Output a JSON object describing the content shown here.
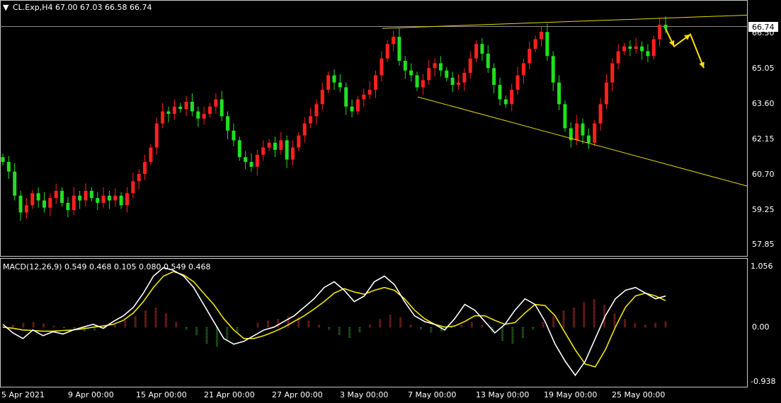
{
  "window": {
    "symbol_header": "CL.Exp,H4  67.00 67.03 66.58 66.74",
    "current_price": "66.74"
  },
  "price_axis": {
    "labels": [
      "66.50",
      "65.05",
      "63.60",
      "62.15",
      "60.70",
      "59.25",
      "57.85"
    ]
  },
  "macd": {
    "header": "MACD(12,26,9) 0.549 0.468 0.105 0.080 0.549 0.468",
    "labels": [
      "1.056",
      "0.00",
      "-0.938"
    ]
  },
  "time_axis": {
    "labels": [
      "5 Apr 2021",
      "9 Apr 00:00",
      "15 Apr 00:00",
      "21 Apr 00:00",
      "27 Apr 00:00",
      "3 May 00:00",
      "7 May 00:00",
      "13 May 00:00",
      "19 May 00:00",
      "25 May 00:00"
    ]
  },
  "colors": {
    "bull": "#ff2020",
    "bear": "#20e020",
    "macd_line": "#ffffff",
    "signal_line": "#f2e600",
    "trendline": "#e6d800",
    "arrow": "#ffe000",
    "grid_ref": "#8a8a8a"
  },
  "chart_data": {
    "type": "candlestick",
    "symbol": "CL.Exp",
    "timeframe": "H4",
    "ohlc_last": {
      "open": 67.0,
      "high": 67.03,
      "low": 66.58,
      "close": 66.74
    },
    "y_range": [
      57.5,
      67.4
    ],
    "closes": [
      61.2,
      60.8,
      59.8,
      59.1,
      59.4,
      59.9,
      59.6,
      59.3,
      59.7,
      60.0,
      59.5,
      59.2,
      59.8,
      59.6,
      60.0,
      59.7,
      59.5,
      59.8,
      59.6,
      59.8,
      59.4,
      59.9,
      60.4,
      60.7,
      61.2,
      61.8,
      62.8,
      63.3,
      63.2,
      63.5,
      63.4,
      63.7,
      63.3,
      63.0,
      63.2,
      63.5,
      63.8,
      63.1,
      62.5,
      62.1,
      61.4,
      61.2,
      61.0,
      61.5,
      61.8,
      62.0,
      61.7,
      62.1,
      61.3,
      61.8,
      62.3,
      62.8,
      63.1,
      63.6,
      64.2,
      64.8,
      64.5,
      64.3,
      63.5,
      63.3,
      63.8,
      64.0,
      64.2,
      64.8,
      65.5,
      66.1,
      66.4,
      65.4,
      65.0,
      64.8,
      64.3,
      64.6,
      65.1,
      65.3,
      65.0,
      64.7,
      64.4,
      64.5,
      64.9,
      65.5,
      66.1,
      65.7,
      65.1,
      64.4,
      63.8,
      63.6,
      64.2,
      64.8,
      65.3,
      65.9,
      66.3,
      66.6,
      65.6,
      64.5,
      63.6,
      62.6,
      62.1,
      62.8,
      62.3,
      62.0,
      62.8,
      63.6,
      64.5,
      65.3,
      65.8,
      66.0,
      65.9,
      66.0,
      65.8,
      65.6,
      66.3,
      66.9,
      66.74
    ],
    "annotations": {
      "upper_trendline": {
        "from": [
          66.6,
          66.75
        ],
        "to": [
          67.05,
          67.3
        ]
      },
      "lower_trendline": {
        "from": [
          63.9,
          63.9
        ],
        "to": [
          60.2,
          60.2
        ]
      },
      "projected_path": [
        66.74,
        66.0,
        66.5,
        65.1
      ]
    },
    "macd": {
      "params": "12,26,9",
      "y_range": [
        -0.938,
        1.056
      ],
      "main": [
        0.05,
        -0.1,
        -0.2,
        -0.05,
        -0.15,
        -0.08,
        -0.12,
        -0.05,
        0.0,
        0.05,
        -0.02,
        0.1,
        0.2,
        0.35,
        0.6,
        0.9,
        1.05,
        1.0,
        0.9,
        0.7,
        0.4,
        0.1,
        -0.2,
        -0.3,
        -0.25,
        -0.15,
        -0.05,
        0.0,
        0.1,
        0.2,
        0.35,
        0.5,
        0.7,
        0.8,
        0.65,
        0.45,
        0.55,
        0.8,
        0.9,
        0.75,
        0.45,
        0.2,
        0.1,
        0.05,
        -0.05,
        0.15,
        0.4,
        0.3,
        0.1,
        -0.1,
        0.05,
        0.3,
        0.5,
        0.4,
        0.1,
        -0.3,
        -0.6,
        -0.85,
        -0.6,
        -0.2,
        0.2,
        0.5,
        0.65,
        0.7,
        0.6,
        0.5,
        0.549
      ],
      "signal": [
        0.0,
        -0.02,
        -0.05,
        -0.06,
        -0.07,
        -0.07,
        -0.06,
        -0.05,
        -0.03,
        0.0,
        0.02,
        0.05,
        0.12,
        0.25,
        0.45,
        0.7,
        0.9,
        0.98,
        0.92,
        0.8,
        0.6,
        0.4,
        0.15,
        -0.05,
        -0.2,
        -0.2,
        -0.15,
        -0.08,
        0.0,
        0.1,
        0.2,
        0.32,
        0.45,
        0.6,
        0.68,
        0.62,
        0.58,
        0.65,
        0.7,
        0.65,
        0.5,
        0.3,
        0.15,
        0.05,
        0.0,
        0.02,
        0.1,
        0.2,
        0.2,
        0.12,
        0.05,
        0.08,
        0.25,
        0.4,
        0.38,
        0.2,
        -0.1,
        -0.4,
        -0.65,
        -0.7,
        -0.4,
        0.0,
        0.35,
        0.55,
        0.6,
        0.55,
        0.468
      ],
      "histogram": [
        0.02,
        0.05,
        0.08,
        0.1,
        0.06,
        0.03,
        -0.02,
        -0.05,
        -0.08,
        -0.06,
        -0.03,
        0.05,
        0.12,
        0.2,
        0.3,
        0.35,
        0.25,
        0.1,
        -0.05,
        -0.15,
        -0.3,
        -0.35,
        -0.25,
        -0.1,
        0.0,
        0.08,
        0.12,
        0.15,
        0.2,
        0.18,
        0.12,
        0.05,
        -0.05,
        -0.15,
        -0.2,
        -0.1,
        0.05,
        0.15,
        0.22,
        0.18,
        0.05,
        -0.05,
        -0.1,
        -0.08,
        -0.02,
        0.05,
        0.1,
        0.05,
        -0.1,
        -0.25,
        -0.3,
        -0.2,
        -0.05,
        0.1,
        0.2,
        0.3,
        0.35,
        0.45,
        0.5,
        0.4,
        0.25,
        0.15,
        0.08,
        0.05,
        0.08,
        0.105
      ]
    }
  }
}
